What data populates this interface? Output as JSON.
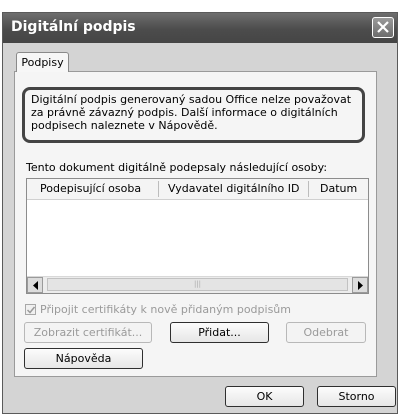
{
  "window": {
    "title": "Digitální podpis"
  },
  "tabs": [
    {
      "label": "Podpisy"
    }
  ],
  "notice": {
    "text": "Digitální podpis generovaný sadou Office nelze považovat za právně závazný podpis. Další informace o digitálních podpisech naleznete v Nápovědě."
  },
  "signers": {
    "label": "Tento dokument digitálně podepsaly následující osoby:",
    "columns": [
      "Podepisující osoba",
      "Vydavatel digitálního ID",
      "Datum"
    ],
    "rows": []
  },
  "attach_certificates": {
    "label": "Připojit certifikáty k nově přidaným podpisům",
    "checked": true,
    "enabled": false
  },
  "buttons": {
    "view_certificate": "Zobrazit certifikát...",
    "add": "Přidat...",
    "remove": "Odebrat",
    "help": "Nápověda",
    "ok": "OK",
    "cancel": "Storno"
  },
  "icons": {
    "close": "close-icon",
    "scroll_left": "arrow-left-icon",
    "scroll_right": "arrow-right-icon",
    "checkmark": "checkmark-icon"
  }
}
